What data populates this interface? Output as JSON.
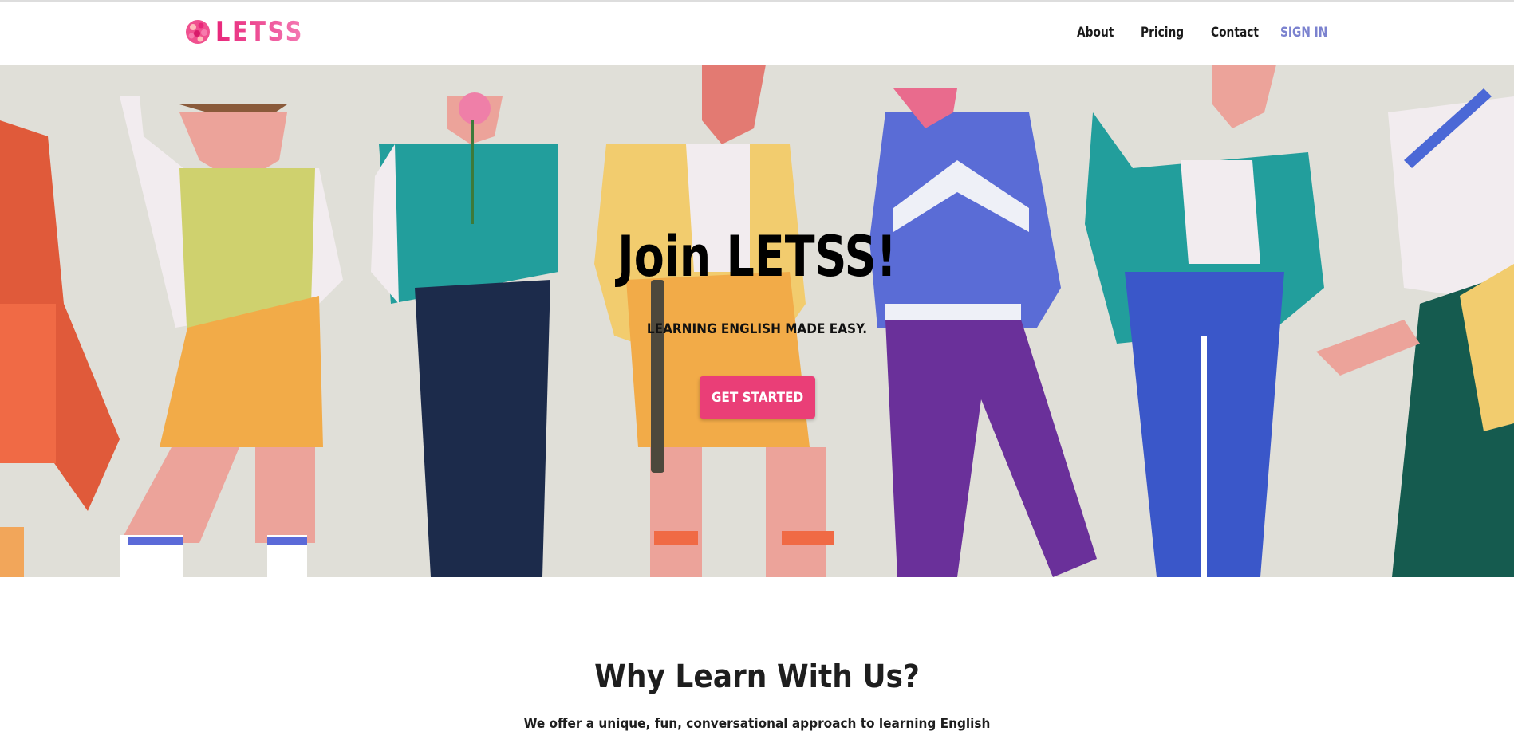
{
  "header": {
    "logo_text": "LETSS",
    "nav": [
      {
        "label": "About"
      },
      {
        "label": "Pricing"
      },
      {
        "label": "Contact"
      },
      {
        "label": "SIGN IN"
      }
    ]
  },
  "hero": {
    "title": "Join LETSS!",
    "subtitle": "LEARNING ENGLISH MADE EASY.",
    "cta_label": "GET STARTED",
    "cta_color": "#ea3e77",
    "background_color": "#e0dfd8"
  },
  "why": {
    "title": "Why Learn With Us?",
    "subtitle": "We offer a unique, fun, conversational approach to learning English"
  },
  "colors": {
    "brand_pink": "#e8267a",
    "sign_in": "#7b82cf"
  }
}
